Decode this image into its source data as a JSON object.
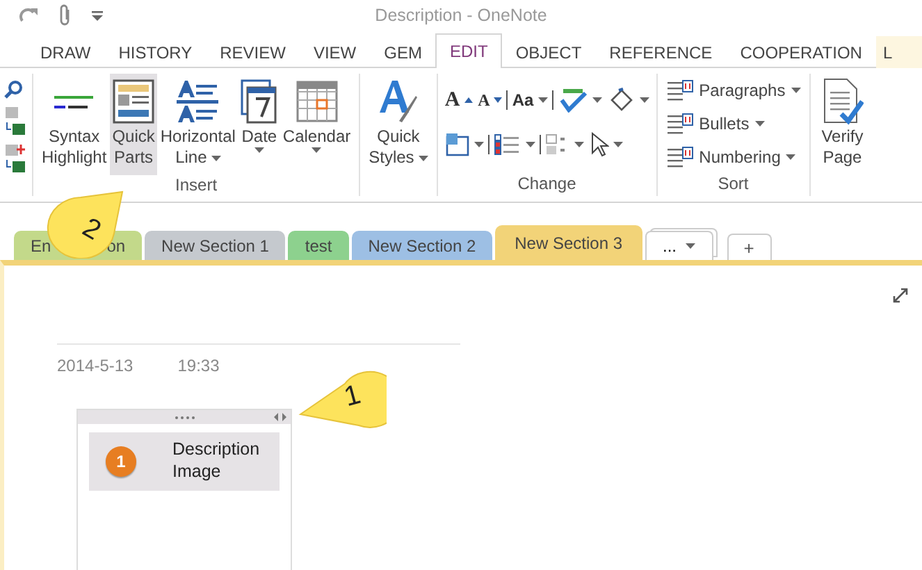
{
  "title_bar": {
    "title": "Description - OneNote"
  },
  "ribbon_tabs": [
    {
      "label": "DRAW",
      "selected": false
    },
    {
      "label": "HISTORY",
      "selected": false
    },
    {
      "label": "REVIEW",
      "selected": false
    },
    {
      "label": "VIEW",
      "selected": false
    },
    {
      "label": "GEM",
      "selected": false
    },
    {
      "label": "EDIT",
      "selected": true
    },
    {
      "label": "OBJECT",
      "selected": false
    },
    {
      "label": "REFERENCE",
      "selected": false
    },
    {
      "label": "COOPERATION",
      "selected": false
    },
    {
      "label": "L",
      "selected": false
    }
  ],
  "insert_buttons": [
    {
      "kind": "syntax",
      "lines": [
        "Syntax",
        "Highlight"
      ],
      "dropdown": false,
      "selected": false
    },
    {
      "kind": "parts",
      "lines": [
        "Quick",
        "Parts"
      ],
      "dropdown": false,
      "selected": true
    },
    {
      "kind": "hline",
      "lines": [
        "Horizontal",
        "Line"
      ],
      "dropdown": true,
      "selected": false
    },
    {
      "kind": "date",
      "lines": [
        "Date"
      ],
      "dropdown": true,
      "selected": false
    },
    {
      "kind": "calendar",
      "lines": [
        "Calendar"
      ],
      "dropdown": true,
      "selected": false
    }
  ],
  "groups": {
    "insert": "Insert",
    "change": "Change",
    "sort": "Sort"
  },
  "styles_button": {
    "lines": [
      "Quick",
      "Styles"
    ],
    "dropdown": true
  },
  "change_rows": [
    [
      {
        "kind": "grow",
        "glyph": "A",
        "dropdown": false
      },
      {
        "kind": "shrink",
        "glyph": "A",
        "dropdown": false
      },
      {
        "kind": "sep"
      },
      {
        "kind": "case",
        "glyph": "Aa",
        "dropdown": true
      },
      {
        "kind": "sep"
      },
      {
        "kind": "spell",
        "dropdown": true
      },
      {
        "kind": "bucket",
        "dropdown": true
      }
    ],
    [
      {
        "kind": "numbox",
        "dropdown": true
      },
      {
        "kind": "sep"
      },
      {
        "kind": "checklist",
        "dropdown": true
      },
      {
        "kind": "sep"
      },
      {
        "kind": "graylist",
        "dropdown": true
      },
      {
        "kind": "cursor",
        "dropdown": true
      }
    ]
  ],
  "sort_items": [
    {
      "label": "Paragraphs",
      "dropdown": true
    },
    {
      "label": "Bullets",
      "dropdown": true
    },
    {
      "label": "Numbering",
      "dropdown": true
    }
  ],
  "verify_button": {
    "lines": [
      "Verify",
      "Page"
    ]
  },
  "section_tabs": [
    {
      "label_start": "En",
      "label_end": "on",
      "color": "#c3d98a",
      "selected": false
    },
    {
      "label": "New Section 1",
      "color": "#c5c9ce",
      "selected": false
    },
    {
      "label": "test",
      "color": "#8dd18e",
      "selected": false
    },
    {
      "label": "New Section 2",
      "color": "#9dbfe4",
      "selected": false
    },
    {
      "label": "New Section 3",
      "color": "#f2d378",
      "selected": true
    }
  ],
  "more_tabs": {
    "label": "..."
  },
  "add_tab": {
    "label": "+"
  },
  "page": {
    "date": "2014-5-13",
    "time": "19:33",
    "note": {
      "badge": "1",
      "lines": [
        "Description",
        "Image"
      ]
    }
  },
  "callouts": [
    {
      "number": "2"
    },
    {
      "number": "1"
    }
  ]
}
